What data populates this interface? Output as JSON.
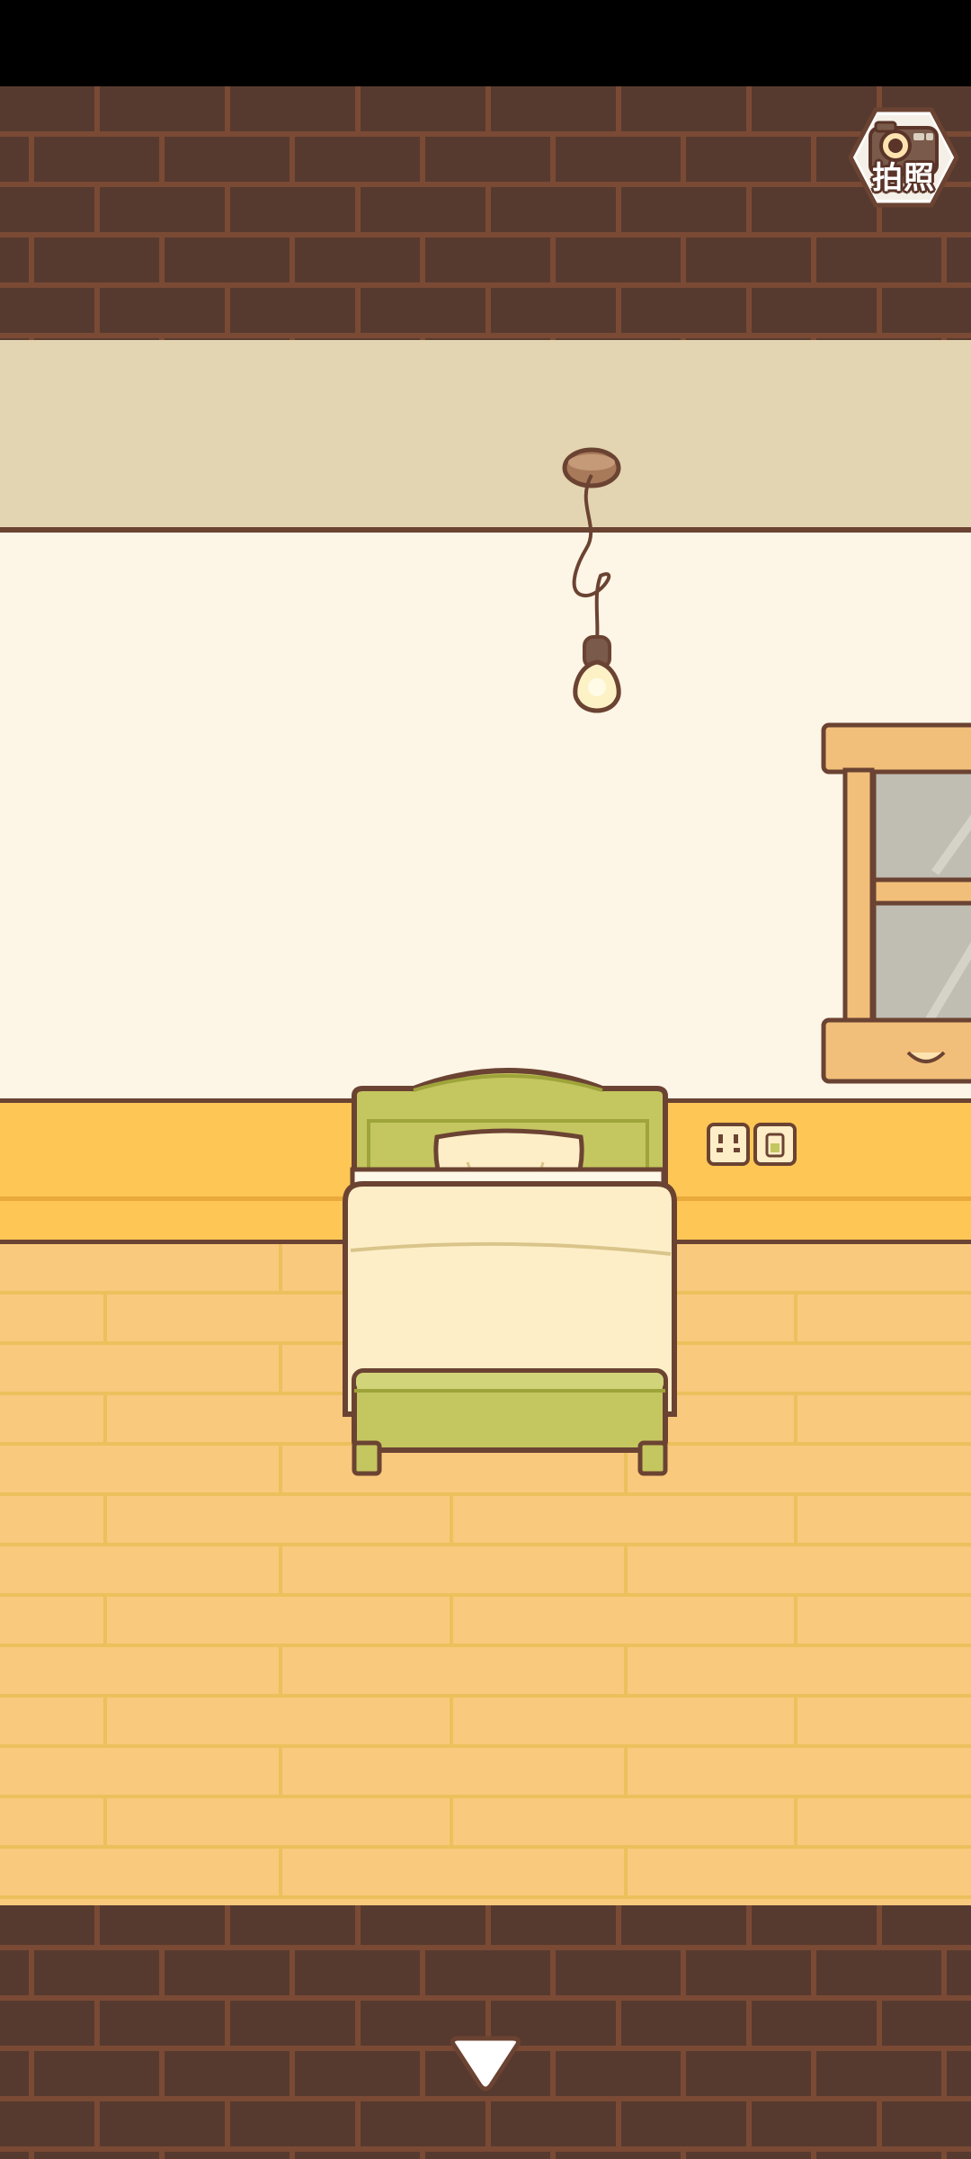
{
  "screen": {
    "name": "bedroom-scene"
  },
  "camera_button": {
    "label": "拍照",
    "icon": "camera-icon"
  },
  "navigation": {
    "down_icon": "chevron-down-icon"
  },
  "colors": {
    "top_bar": "#000000",
    "brick": "#573a2f",
    "mortar": "#7a4a35",
    "ceiling": "#e3d5b1",
    "wall": "#fdf5e6",
    "baseboard": "#fec654",
    "floor": "#f9c97d",
    "floor_line": "#ecc05c",
    "outline": "#6b4332",
    "bed_green": "#c4c660",
    "bed_cream": "#fdeec7",
    "window_wood": "#f2bf7a",
    "glass": "#c0beb3"
  },
  "objects": [
    "ceiling-lamp",
    "bed",
    "wall-outlet",
    "window"
  ]
}
